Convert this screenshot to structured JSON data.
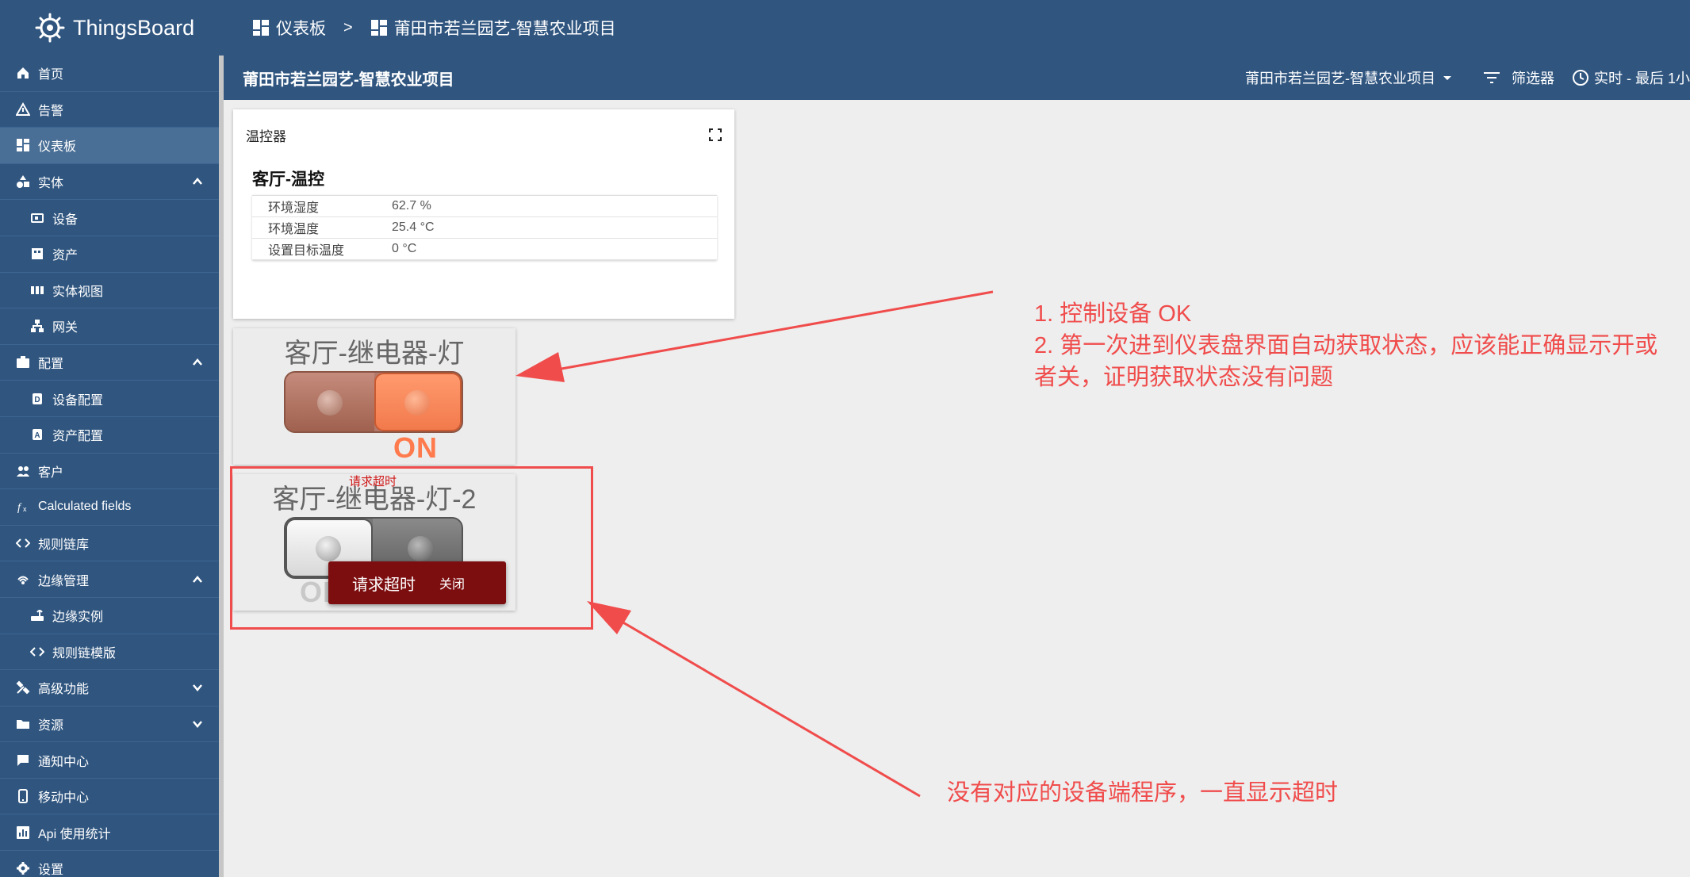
{
  "app": {
    "name": "ThingsBoard"
  },
  "breadcrumb": {
    "root": "仪表板",
    "separator": ">",
    "current": "莆田市若兰园艺-智慧农业项目"
  },
  "sidebar": {
    "items": [
      {
        "label": "首页",
        "icon": "home-icon"
      },
      {
        "label": "告警",
        "icon": "warning-icon"
      },
      {
        "label": "仪表板",
        "icon": "dashboard-icon",
        "active": true
      },
      {
        "label": "实体",
        "icon": "entity-icon",
        "expanded": true
      },
      {
        "label": "设备",
        "icon": "device-icon",
        "sub": true
      },
      {
        "label": "资产",
        "icon": "asset-icon",
        "sub": true
      },
      {
        "label": "实体视图",
        "icon": "entity-view-icon",
        "sub": true
      },
      {
        "label": "网关",
        "icon": "gateway-icon",
        "sub": true
      },
      {
        "label": "配置",
        "icon": "profile-icon",
        "expanded": true
      },
      {
        "label": "设备配置",
        "icon": "device-profile-icon",
        "sub": true
      },
      {
        "label": "资产配置",
        "icon": "asset-profile-icon",
        "sub": true
      },
      {
        "label": "客户",
        "icon": "customers-icon"
      },
      {
        "label": "Calculated fields",
        "icon": "function-icon"
      },
      {
        "label": "规则链库",
        "icon": "code-icon"
      },
      {
        "label": "边缘管理",
        "icon": "edge-icon",
        "expanded": true
      },
      {
        "label": "边缘实例",
        "icon": "router-icon",
        "sub": true
      },
      {
        "label": "规则链模版",
        "icon": "code-icon",
        "sub": true
      },
      {
        "label": "高级功能",
        "icon": "tools-icon",
        "collapsed": true
      },
      {
        "label": "资源",
        "icon": "folder-icon",
        "collapsed": true
      },
      {
        "label": "通知中心",
        "icon": "notification-icon"
      },
      {
        "label": "移动中心",
        "icon": "mobile-icon"
      },
      {
        "label": "Api 使用统计",
        "icon": "api-usage-icon"
      },
      {
        "label": "设置",
        "icon": "settings-icon"
      }
    ]
  },
  "header": {
    "title": "莆田市若兰园艺-智慧农业项目",
    "state_select": "莆田市若兰园艺-智慧农业项目",
    "filter_label": "筛选器",
    "time_label": "实时 - 最后 1小"
  },
  "widgets": {
    "thermostat": {
      "title": "温控器",
      "device": "客厅-温控",
      "rows": [
        {
          "key": "环境湿度",
          "value": "62.7 %"
        },
        {
          "key": "环境温度",
          "value": "25.4 °C"
        },
        {
          "key": "设置目标温度",
          "value": "0 °C"
        }
      ]
    },
    "switch1": {
      "title": "客厅-继电器-灯",
      "state": "ON"
    },
    "switch2": {
      "title": "客厅-继电器-灯-2",
      "state": "OFF",
      "state_visible": "OI",
      "inline_error": "请求超时",
      "toast_message": "请求超时",
      "toast_action": "关闭"
    }
  },
  "annotations": {
    "note1_line1": "1. 控制设备 OK",
    "note1_line2": "2. 第一次进到仪表盘界面自动获取状态，应该能正确显示开或",
    "note1_line3": "者关，证明获取状态没有问题",
    "note2": "没有对应的设备端程序，一直显示超时",
    "color": "#f04c4c"
  },
  "colors": {
    "brand": "#305680",
    "switch_on": "#ff8a5c",
    "toast_bg": "#7d0e10"
  }
}
